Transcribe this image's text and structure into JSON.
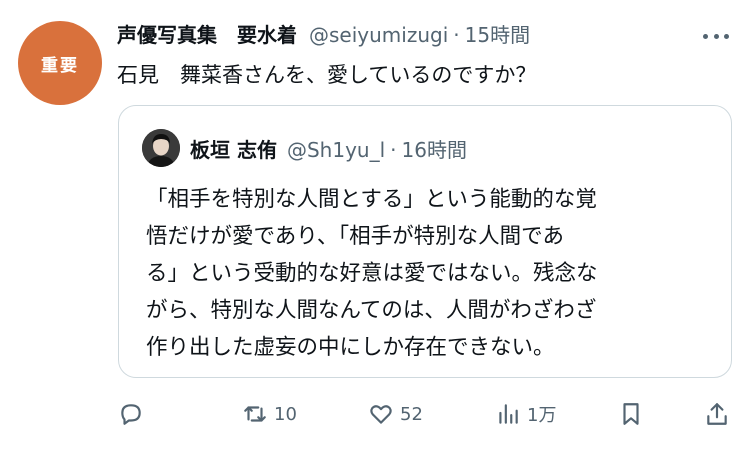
{
  "post": {
    "avatar_text": "重要",
    "author_name": "声優写真集　要水着",
    "author_handle": "@seiyumizugi",
    "separator": "·",
    "time": "15時間",
    "text": "石見　舞菜香さんを、愛しているのですか？"
  },
  "quote": {
    "author_name": "板垣 志侑",
    "author_handle": "@Sh1yu_l",
    "separator": "·",
    "time": "16時間",
    "lines": [
      "「相手を特別な人間とする」という能動的な覚",
      "悟だけが愛であり、「相手が特別な人間であ",
      "る」という受動的な好意は愛ではない。残念な",
      "がら、特別な人間なんてのは、人間がわざわざ",
      "作り出した虚妄の中にしか存在できない。"
    ]
  },
  "actions": {
    "reply_icon": "reply-icon",
    "retweet_count": "10",
    "like_count": "52",
    "views_count": "1万",
    "bookmark_icon": "bookmark-icon",
    "share_icon": "share-icon"
  },
  "colors": {
    "avatar_bg": "#d9713c",
    "muted_text": "#536471",
    "border": "#cfd9de"
  }
}
